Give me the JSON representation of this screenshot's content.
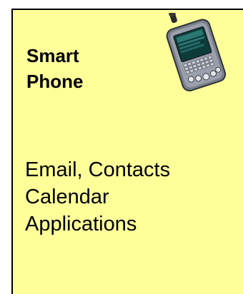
{
  "card": {
    "title_line1": "Smart",
    "title_line2": "Phone",
    "icon": "smartphone-icon",
    "items": [
      "Email, Contacts",
      "Calendar",
      "Applications"
    ],
    "background_color": "#ffff99",
    "border_color": "#000000"
  }
}
